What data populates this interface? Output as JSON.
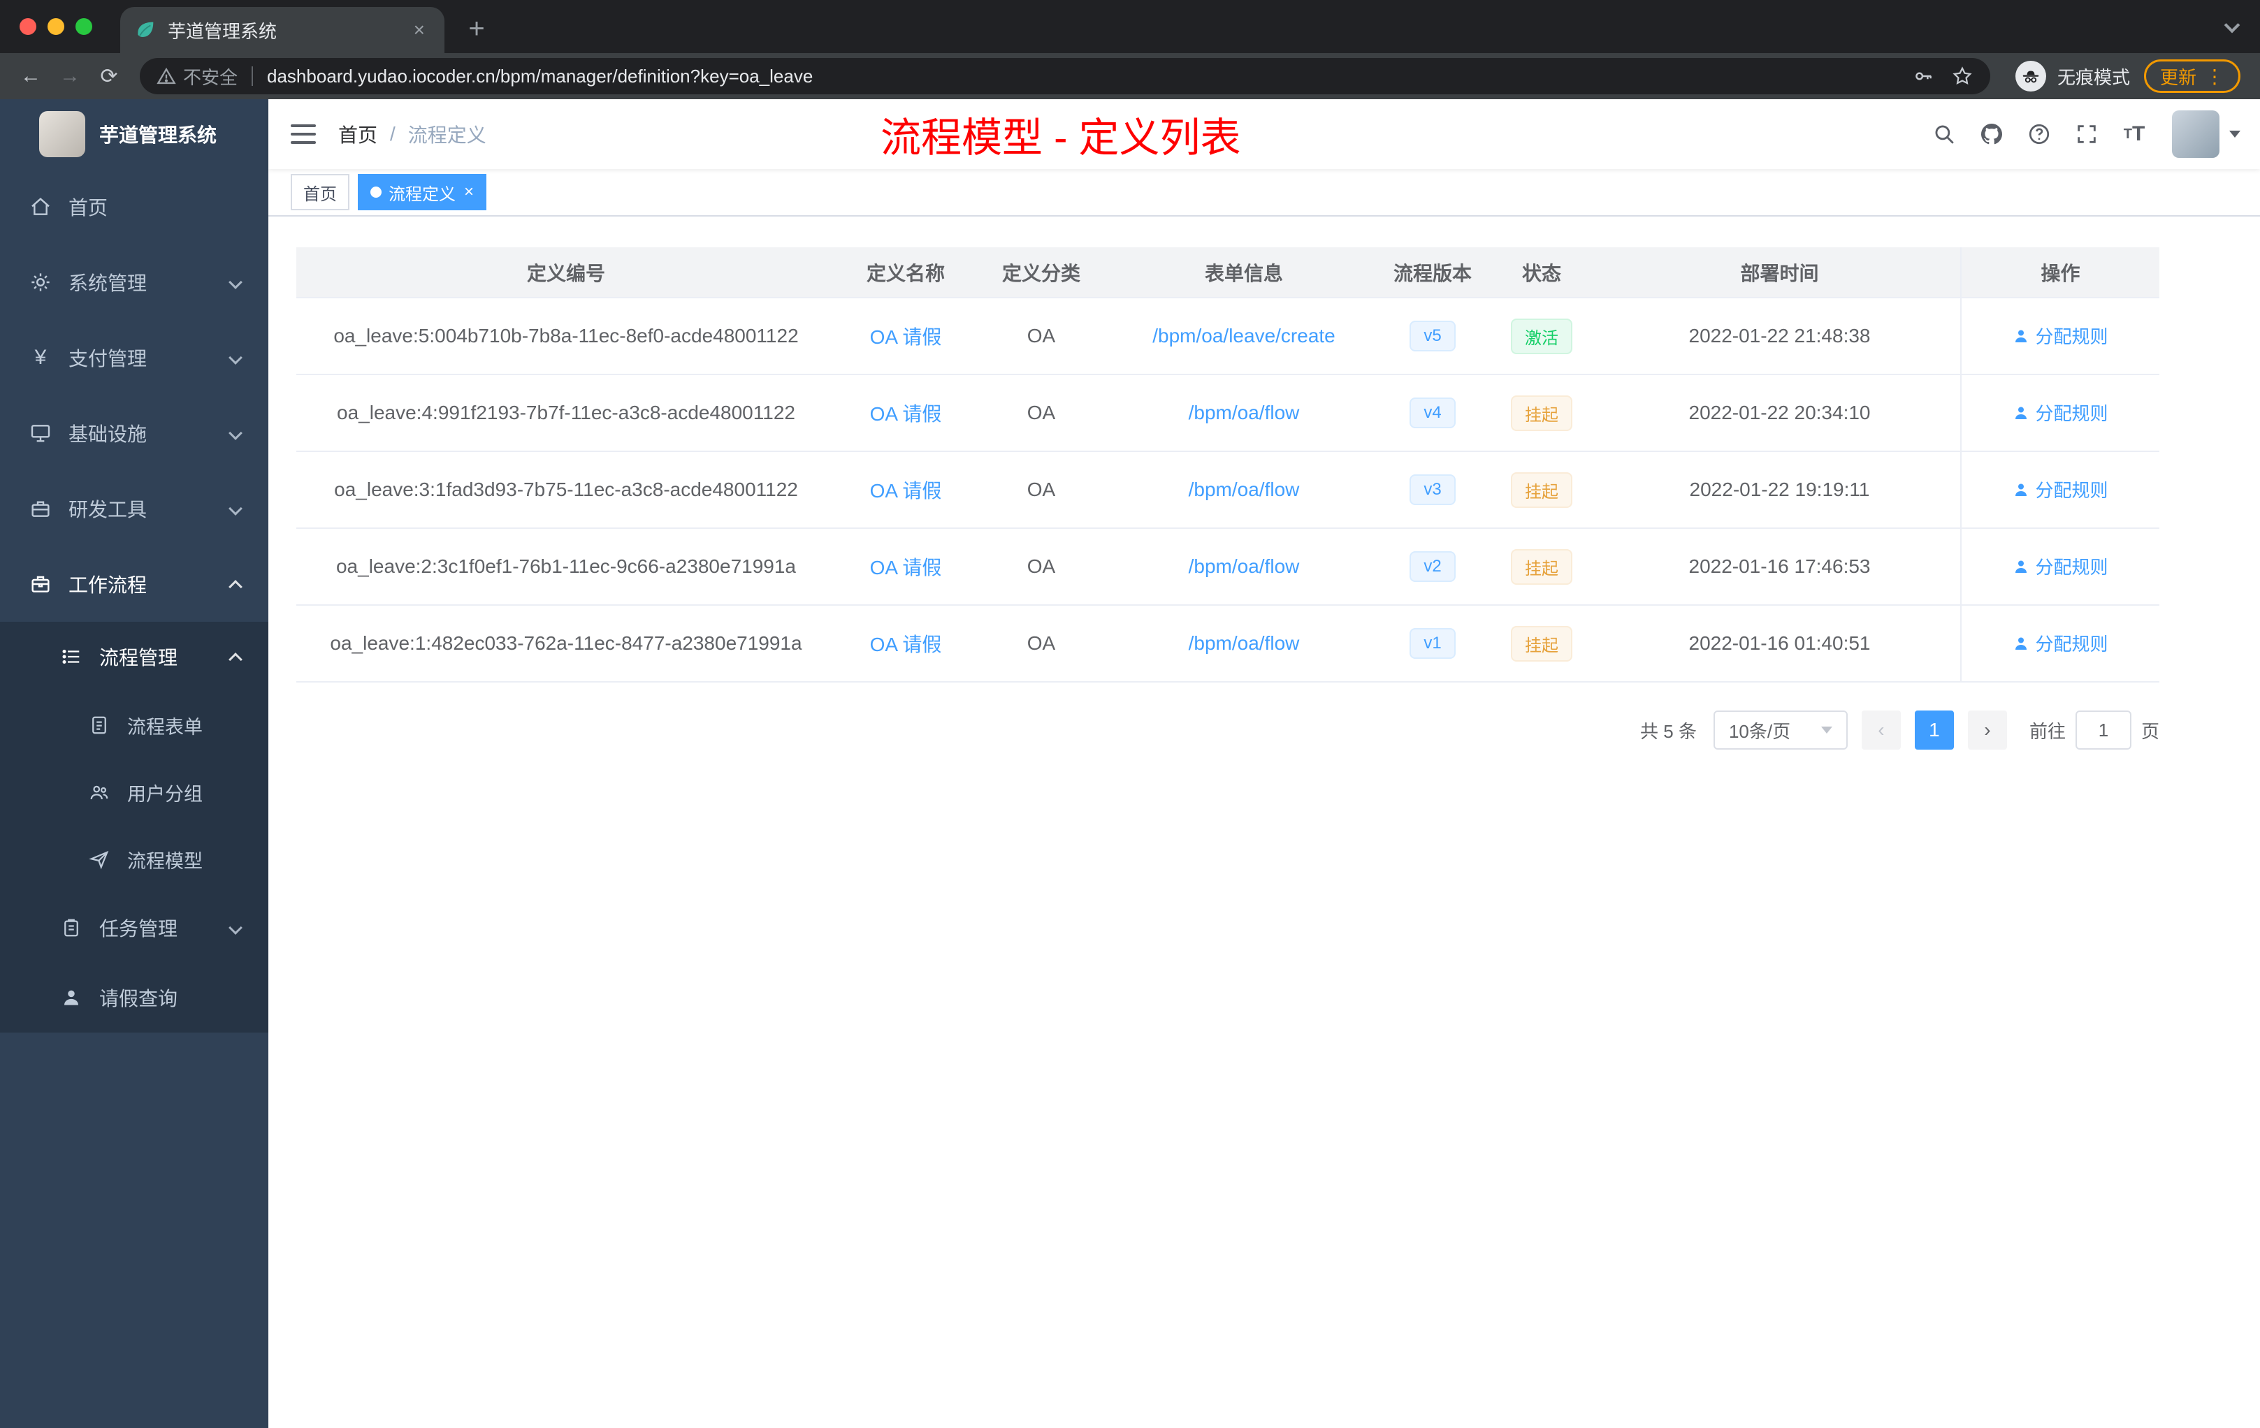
{
  "browser": {
    "tab": {
      "title": "芋道管理系统",
      "close": "×"
    },
    "new_tab": "+",
    "back": "←",
    "forward": "→",
    "reload": "⟳",
    "security_label": "不安全",
    "url": "dashboard.yudao.iocoder.cn/bpm/manager/definition?key=oa_leave",
    "incognito_label": "无痕模式",
    "update_label": "更新",
    "menu_dots": "⋮"
  },
  "sidebar": {
    "logo_title": "芋道管理系统",
    "menu": [
      {
        "label": "首页",
        "icon": "home-icon"
      },
      {
        "label": "系统管理",
        "icon": "gear-icon"
      },
      {
        "label": "支付管理",
        "icon": "yen-icon"
      },
      {
        "label": "基础设施",
        "icon": "monitor-icon"
      },
      {
        "label": "研发工具",
        "icon": "toolbox-icon"
      },
      {
        "label": "工作流程",
        "icon": "briefcase-icon"
      }
    ],
    "submenu": [
      {
        "label": "流程管理",
        "icon": "list-icon"
      },
      {
        "label": "流程表单",
        "icon": "document-icon"
      },
      {
        "label": "用户分组",
        "icon": "users-icon"
      },
      {
        "label": "流程模型",
        "icon": "send-icon"
      },
      {
        "label": "任务管理",
        "icon": "clipboard-icon"
      },
      {
        "label": "请假查询",
        "icon": "person-icon"
      }
    ]
  },
  "header": {
    "breadcrumb_home": "首页",
    "breadcrumb_sep": "/",
    "breadcrumb_current": "流程定义",
    "annotation": "流程模型 - 定义列表"
  },
  "tags": {
    "home": "首页",
    "active": "流程定义",
    "close": "×"
  },
  "table": {
    "columns": [
      "定义编号",
      "定义名称",
      "定义分类",
      "表单信息",
      "流程版本",
      "状态",
      "部署时间",
      "操作"
    ],
    "rows": [
      {
        "id": "oa_leave:5:004b710b-7b8a-11ec-8ef0-acde48001122",
        "name": "OA 请假",
        "category": "OA",
        "form": "/bpm/oa/leave/create",
        "version": "v5",
        "status": "激活",
        "time": "2022-01-22 21:48:38",
        "action": "分配规则"
      },
      {
        "id": "oa_leave:4:991f2193-7b7f-11ec-a3c8-acde48001122",
        "name": "OA 请假",
        "category": "OA",
        "form": "/bpm/oa/flow",
        "version": "v4",
        "status": "挂起",
        "time": "2022-01-22 20:34:10",
        "action": "分配规则"
      },
      {
        "id": "oa_leave:3:1fad3d93-7b75-11ec-a3c8-acde48001122",
        "name": "OA 请假",
        "category": "OA",
        "form": "/bpm/oa/flow",
        "version": "v3",
        "status": "挂起",
        "time": "2022-01-22 19:19:11",
        "action": "分配规则"
      },
      {
        "id": "oa_leave:2:3c1f0ef1-76b1-11ec-9c66-a2380e71991a",
        "name": "OA 请假",
        "category": "OA",
        "form": "/bpm/oa/flow",
        "version": "v2",
        "status": "挂起",
        "time": "2022-01-16 17:46:53",
        "action": "分配规则"
      },
      {
        "id": "oa_leave:1:482ec033-762a-11ec-8477-a2380e71991a",
        "name": "OA 请假",
        "category": "OA",
        "form": "/bpm/oa/flow",
        "version": "v1",
        "status": "挂起",
        "time": "2022-01-16 01:40:51",
        "action": "分配规则"
      }
    ]
  },
  "pagination": {
    "total": "共 5 条",
    "page_size": "10条/页",
    "prev": "‹",
    "page": "1",
    "next": "›",
    "goto_label": "前往",
    "goto_value": "1",
    "unit": "页"
  },
  "colors": {
    "accent": "#409eff",
    "success": "#13ce66",
    "warning": "#e6a23c",
    "annotation_red": "#fe0000",
    "sidebar_bg": "#304156",
    "submenu_bg": "#263445"
  }
}
